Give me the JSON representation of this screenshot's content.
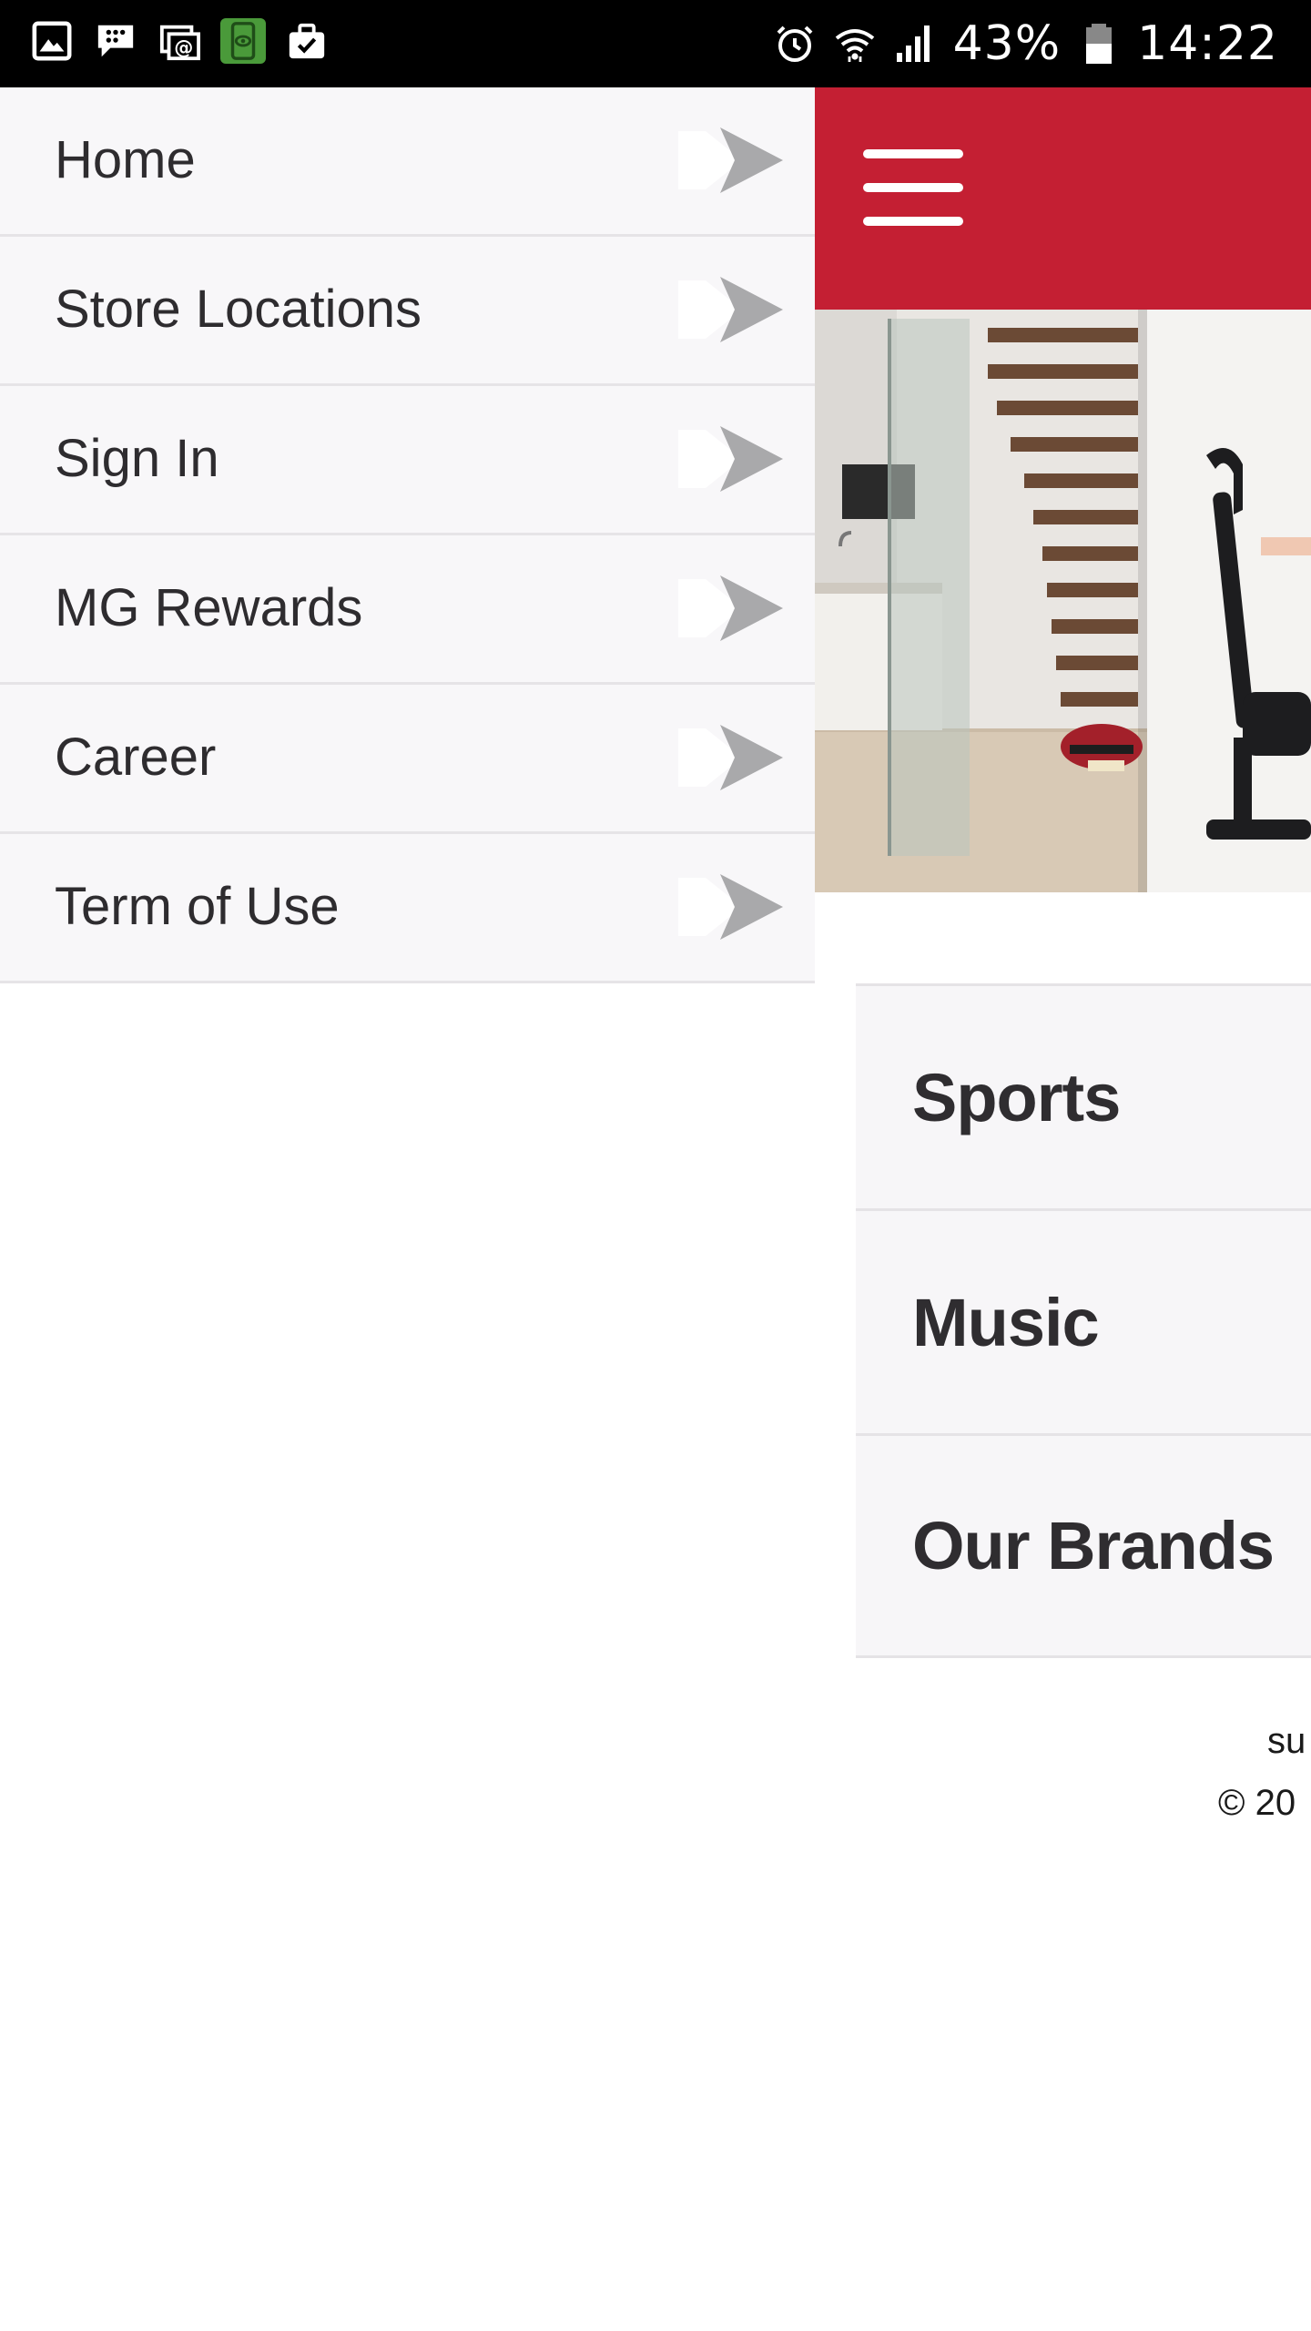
{
  "status_bar": {
    "notification_icons": [
      "gallery-icon",
      "bbm-icon",
      "email-icon",
      "eye-app-icon",
      "briefcase-icon"
    ],
    "system_icons": [
      "alarm-icon",
      "wifi-icon",
      "signal-icon",
      "battery-icon"
    ],
    "battery_percent": "43%",
    "time": "14:22"
  },
  "drawer": {
    "items": [
      {
        "label": "Home",
        "icon": "chevron-right-icon"
      },
      {
        "label": "Store Locations",
        "icon": "chevron-right-icon"
      },
      {
        "label": "Sign In",
        "icon": "chevron-right-icon"
      },
      {
        "label": "MG Rewards",
        "icon": "chevron-right-icon"
      },
      {
        "label": "Career",
        "icon": "chevron-right-icon"
      },
      {
        "label": "Term of Use",
        "icon": "chevron-right-icon"
      }
    ]
  },
  "app": {
    "header_color": "#c41f33",
    "menu_icon": "hamburger-menu-icon",
    "categories": [
      {
        "label": "Sports"
      },
      {
        "label": "Music"
      },
      {
        "label": "Our Brands"
      }
    ],
    "footer": {
      "line1": "su",
      "line2": "© 20"
    }
  },
  "colors": {
    "brand_red": "#c41f33",
    "drawer_bg": "#f8f7f9",
    "text_dark": "#2e2c2f",
    "arrow_gray": "#a9a9ab"
  }
}
